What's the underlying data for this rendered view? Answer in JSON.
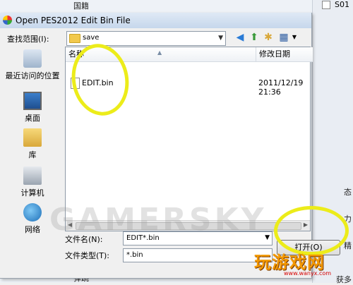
{
  "background": {
    "top_label": "国籍",
    "top_right": "S01",
    "bottom_label": "弹跳",
    "right_fragments": [
      "态",
      "力",
      "精",
      "获多"
    ]
  },
  "dialog": {
    "title": "Open PES2012 Edit Bin File",
    "lookin_label": "查找范围(I):",
    "lookin_value": "save",
    "places": [
      "最近访问的位置",
      "桌面",
      "库",
      "计算机",
      "网络"
    ],
    "columns": {
      "name": "名称",
      "date": "修改日期"
    },
    "files": [
      {
        "name": "EDIT.bin",
        "date": "2011/12/19 21:36"
      }
    ],
    "filename_label": "文件名(N):",
    "filename_value": "EDIT*.bin",
    "filetype_label": "文件类型(T):",
    "filetype_value": "*.bin",
    "open_button": "打开(O)"
  },
  "overlay": {
    "logo": "玩游戏网",
    "logo_url": "www.wanyx.com",
    "watermark": "GAMERSKY"
  },
  "colors": {
    "highlight": "#ecec1a",
    "logo": "#f39800"
  }
}
